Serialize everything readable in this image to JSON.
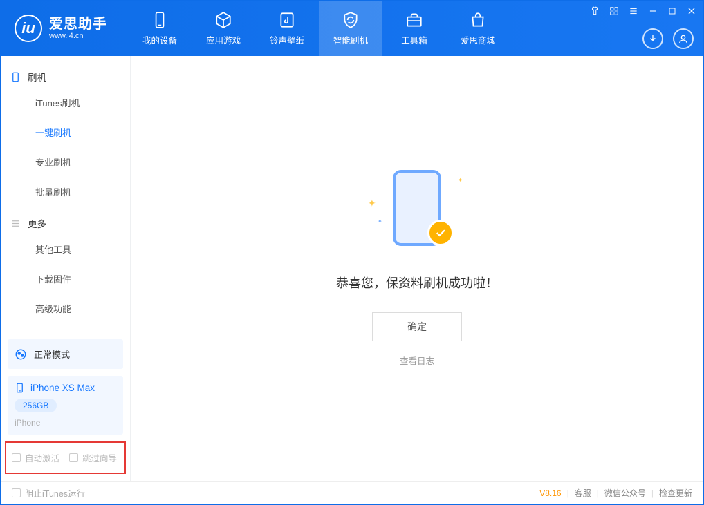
{
  "app": {
    "name": "爱思助手",
    "url": "www.i4.cn"
  },
  "tabs": [
    {
      "label": "我的设备"
    },
    {
      "label": "应用游戏"
    },
    {
      "label": "铃声壁纸"
    },
    {
      "label": "智能刷机"
    },
    {
      "label": "工具箱"
    },
    {
      "label": "爱思商城"
    }
  ],
  "sidebar": {
    "section1": {
      "title": "刷机",
      "items": [
        "iTunes刷机",
        "一键刷机",
        "专业刷机",
        "批量刷机"
      ]
    },
    "section2": {
      "title": "更多",
      "items": [
        "其他工具",
        "下载固件",
        "高级功能"
      ]
    }
  },
  "mode": "正常模式",
  "device": {
    "name": "iPhone XS Max",
    "storage": "256GB",
    "type": "iPhone"
  },
  "options": {
    "autoActivate": "自动激活",
    "skipGuide": "跳过向导"
  },
  "main": {
    "success": "恭喜您，保资料刷机成功啦！",
    "ok": "确定",
    "viewLog": "查看日志"
  },
  "footer": {
    "blockItunes": "阻止iTunes运行",
    "version": "V8.16",
    "service": "客服",
    "wechat": "微信公众号",
    "update": "检查更新"
  }
}
